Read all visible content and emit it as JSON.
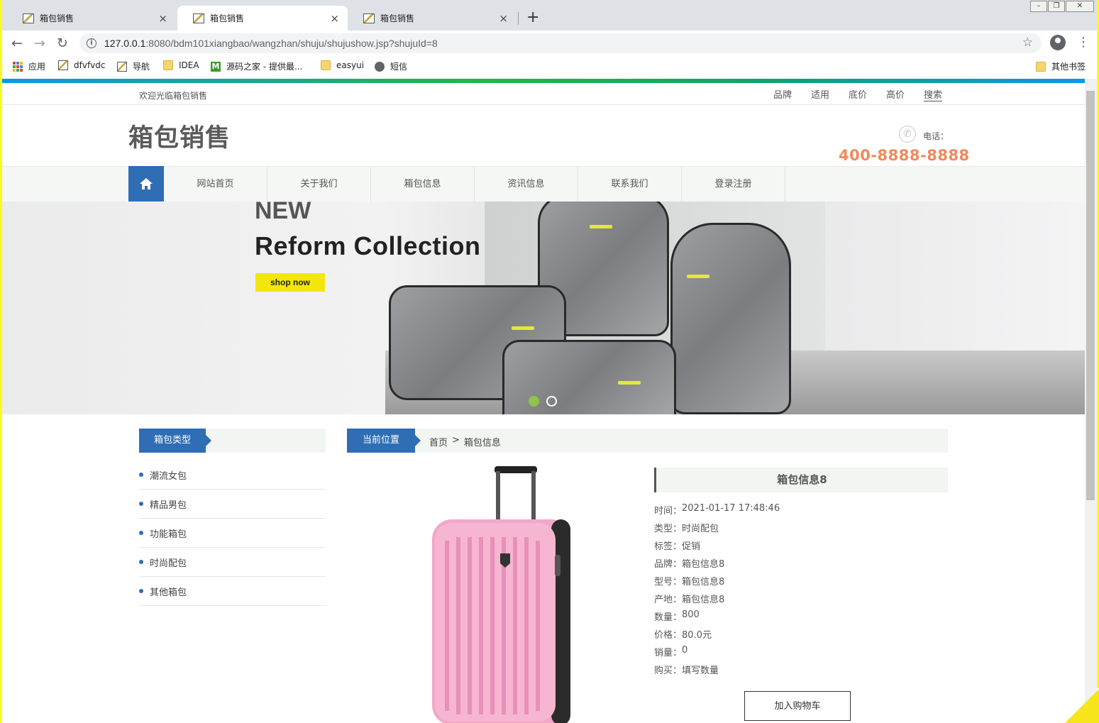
{
  "browser": {
    "tabs": [
      {
        "title": "箱包销售",
        "close": "×"
      },
      {
        "title": "箱包销售",
        "close": "×"
      },
      {
        "title": "箱包销售",
        "close": "×"
      }
    ],
    "new_tab": "+",
    "url_host": "127.0.0.1",
    "url_path": ":8080/bdm101xiangbao/wangzhan/shuju/shujushow.jsp?shujuId=8",
    "bookmarks": [
      {
        "label": "应用",
        "icon": "apps-icon"
      },
      {
        "label": "dfvfvdc",
        "icon": "image-icon"
      },
      {
        "label": "导航",
        "icon": "image-icon"
      },
      {
        "label": "IDEA",
        "icon": "folder-icon"
      },
      {
        "label": "源码之家 - 提供最...",
        "icon": "m-icon"
      },
      {
        "label": "easyui",
        "icon": "folder-icon"
      },
      {
        "label": "短信",
        "icon": "globe-icon"
      }
    ],
    "other_bookmarks": "其他书签"
  },
  "site": {
    "welcome": "欢迎光临箱包销售",
    "top_links": [
      "品牌",
      "适用",
      "底价",
      "高价",
      "搜索"
    ],
    "logo": "箱包销售",
    "phone_label": "电话：",
    "phone_number": "400-8888-8888",
    "nav": [
      "网站首页",
      "关于我们",
      "箱包信息",
      "资讯信息",
      "联系我们",
      "登录注册"
    ],
    "accent_color": "#2f6db5"
  },
  "banner": {
    "headline_small": "NEW",
    "headline": "Reform Collection",
    "cta": "shop now",
    "slides": 2,
    "active_slide": 1
  },
  "sidebar": {
    "title": "箱包类型",
    "categories": [
      "潮流女包",
      "精品男包",
      "功能箱包",
      "时尚配包",
      "其他箱包"
    ]
  },
  "breadcrumb": {
    "label": "当前位置",
    "items": [
      "首页",
      ">",
      "箱包信息"
    ]
  },
  "product": {
    "title": "箱包信息8",
    "details": [
      {
        "label": "时间：",
        "value": "2021-01-17 17:48:46"
      },
      {
        "label": "类型：",
        "value": "时尚配包"
      },
      {
        "label": "标签：",
        "value": "促销"
      },
      {
        "label": "品牌：",
        "value": "箱包信息8"
      },
      {
        "label": "型号：",
        "value": "箱包信息8"
      },
      {
        "label": "产地：",
        "value": "箱包信息8"
      },
      {
        "label": "数量：",
        "value": "800"
      },
      {
        "label": "价格：",
        "value": "80.0元"
      },
      {
        "label": "销量：",
        "value": "0"
      },
      {
        "label": "购买：",
        "value": "填写数量"
      }
    ],
    "add_to_cart": "加入购物车"
  }
}
